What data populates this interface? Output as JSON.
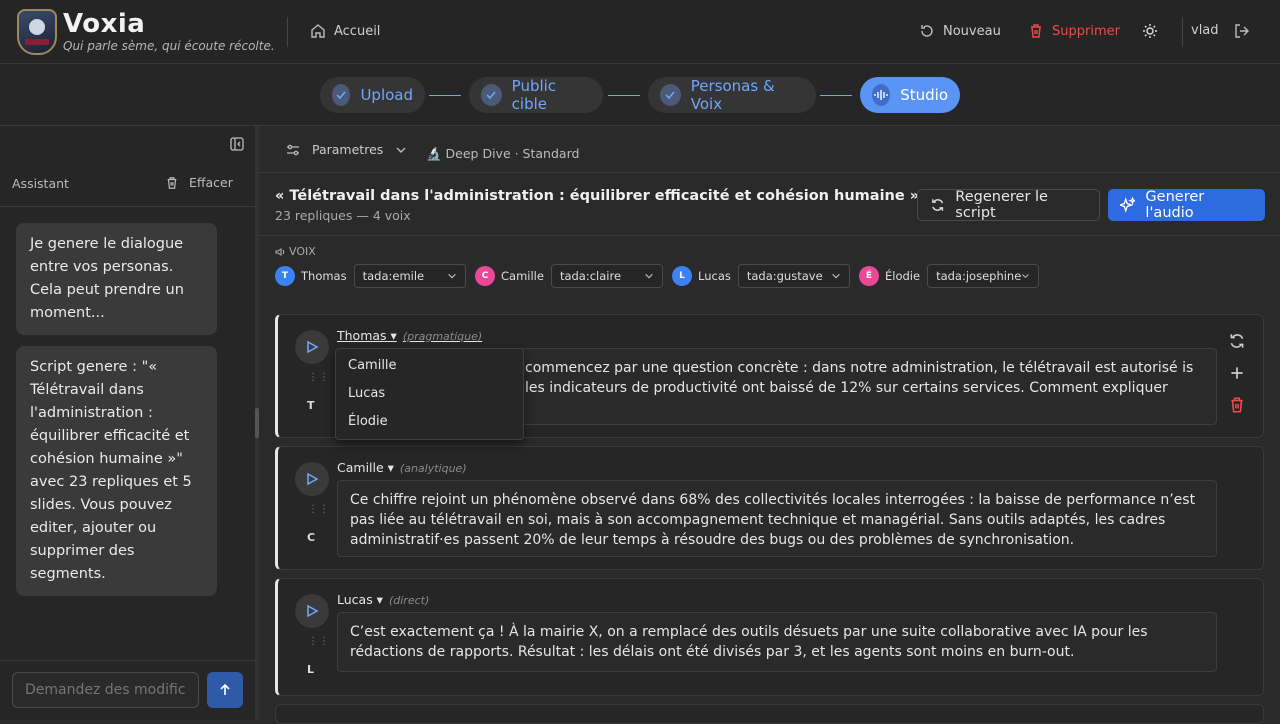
{
  "header": {
    "brand": "Voxia",
    "tagline": "Qui parle sème, qui écoute récolte.",
    "home": "Accueil",
    "new": "Nouveau",
    "delete": "Supprimer",
    "user": "vlad"
  },
  "steps": [
    {
      "label": "Upload"
    },
    {
      "label": "Public cible"
    },
    {
      "label": "Personas & Voix"
    },
    {
      "label": "Studio"
    }
  ],
  "assistant": {
    "title": "Assistant",
    "clear": "Effacer",
    "messages": [
      "Je genere le dialogue entre vos personas. Cela peut prendre un moment...",
      "Script genere : \"« Télétravail dans l'administration : équilibrer efficacité et cohésion humaine »\" avec 23 repliques et 5 slides. Vous pouvez editer, ajouter ou supprimer des segments."
    ],
    "input_placeholder": "Demandez des modifications..."
  },
  "studio": {
    "params": "Parametres",
    "mode": "🔬 Deep Dive · Standard",
    "title": "« Télétravail dans l'administration : équilibrer efficacité et cohésion humaine »",
    "subtitle": "23 repliques — 4 voix",
    "regen": "Regenerer le script",
    "gen_audio": "Generer l'audio",
    "voices_label": "VOIX"
  },
  "voices": [
    {
      "initial": "T",
      "name": "Thomas",
      "voice": "tada:emile",
      "color": "#3b82f6"
    },
    {
      "initial": "C",
      "name": "Camille",
      "voice": "tada:claire",
      "color": "#ec4899"
    },
    {
      "initial": "L",
      "name": "Lucas",
      "voice": "tada:gustave",
      "color": "#3b82f6"
    },
    {
      "initial": "É",
      "name": "Élodie",
      "voice": "tada:josephine",
      "color": "#ec4899"
    }
  ],
  "segments": [
    {
      "initial": "T",
      "speaker": "Thomas ▾",
      "trait": "(pragmatique)",
      "text": "commencez par une question concrète : dans notre administration, le télétravail est autorisé is les indicateurs de productivité ont baissé de 12% sur certains services. Comment expliquer"
    },
    {
      "initial": "C",
      "speaker": "Camille ▾",
      "trait": "(analytique)",
      "text": "Ce chiffre rejoint un phénomène observé dans 68% des collectivités locales interrogées : la baisse de performance n’est pas liée au télétravail en soi, mais à son accompagnement technique et managérial. Sans outils adaptés, les cadres administratif·es passent 20% de leur temps à résoudre des bugs ou des problèmes de synchronisation."
    },
    {
      "initial": "L",
      "speaker": "Lucas ▾",
      "trait": "(direct)",
      "text": "C’est exactement ça ! À la mairie X, on a remplacé des outils désuets par une suite collaborative avec IA pour les rédactions de rapports. Résultat : les délais ont été divisés par 3, et les agents sont moins en burn-out."
    }
  ],
  "dropdown": [
    "Camille",
    "Lucas",
    "Élodie"
  ],
  "colors": {
    "accent": "#5a94f5",
    "danger": "#ef4b4b"
  }
}
